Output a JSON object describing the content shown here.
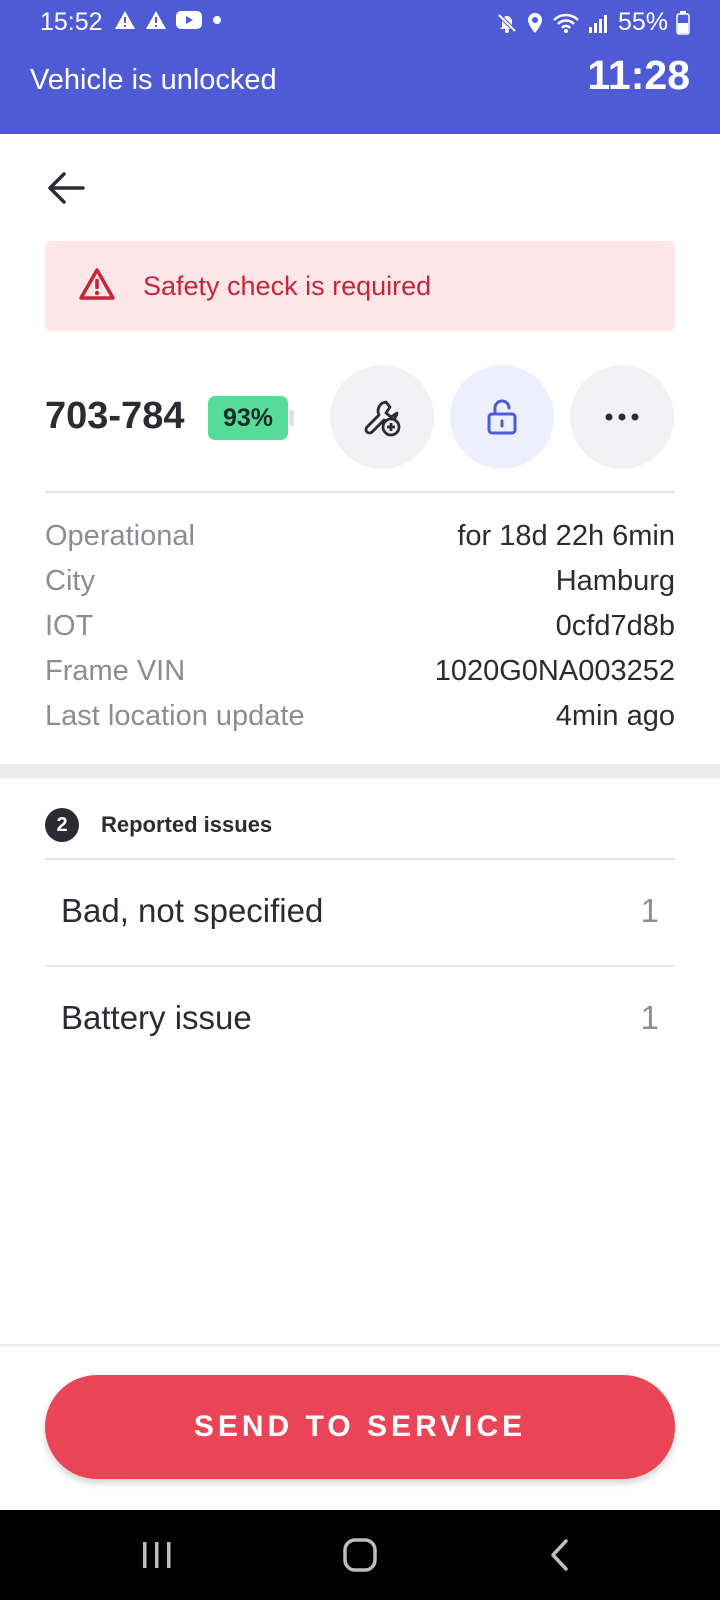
{
  "status_bar": {
    "time": "15:52",
    "battery_percent": "55%",
    "left_icons": [
      "warning-icon",
      "warning-icon",
      "youtube-icon",
      "dot-icon"
    ],
    "right_icons": [
      "mute-icon",
      "location-icon",
      "wifi-icon",
      "signal-icon",
      "battery-icon"
    ]
  },
  "banner": {
    "title": "Vehicle is unlocked",
    "timer": "11:28",
    "color": "#4f5bd5"
  },
  "alert": {
    "text": "Safety check is required",
    "icon": "warning-triangle-icon",
    "color": "#c8243a"
  },
  "vehicle": {
    "id": "703-784",
    "battery": "93%"
  },
  "actions": {
    "service_icon": "wrench-plus-icon",
    "lock_icon": "unlocked-padlock-icon",
    "more_icon": "more-horizontal-icon"
  },
  "info": {
    "rows": [
      {
        "label": "Operational",
        "value": "for 18d 22h 6min"
      },
      {
        "label": "City",
        "value": "Hamburg"
      },
      {
        "label": "IOT",
        "value": "0cfd7d8b"
      },
      {
        "label": "Frame VIN",
        "value": "1020G0NA003252"
      },
      {
        "label": "Last location update",
        "value": "4min ago"
      }
    ]
  },
  "issues": {
    "count": "2",
    "title": "Reported issues",
    "items": [
      {
        "label": "Bad, not specified",
        "count": "1"
      },
      {
        "label": "Battery issue",
        "count": "1"
      }
    ]
  },
  "footer": {
    "send_label": "SEND TO SERVICE",
    "button_color": "#ea4556"
  },
  "nav": {
    "icons": [
      "recent-apps-icon",
      "home-icon",
      "back-icon"
    ]
  }
}
